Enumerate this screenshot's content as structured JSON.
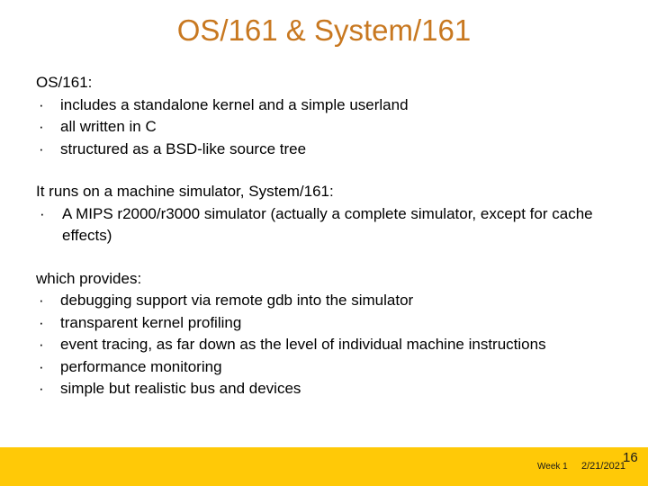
{
  "slide": {
    "title": "OS/161 & System/161",
    "title_color": "#c87820",
    "background_color": "#ffffff",
    "blocks": [
      {
        "lead": "OS/161:",
        "bullets": [
          "includes a standalone kernel and a simple userland",
          "all written in C",
          "structured as a BSD-like source tree"
        ]
      },
      {
        "lead": "It runs on a machine simulator, System/161:",
        "bullets": [
          "A MIPS r2000/r3000 simulator (actually a complete simulator, except for cache effects)"
        ]
      },
      {
        "lead": "which provides:",
        "bullets": [
          "debugging support via remote gdb into the simulator",
          "transparent kernel profiling",
          "event tracing, as far down as the level of individual machine instructions",
          "performance monitoring",
          "simple but realistic bus and devices"
        ]
      }
    ]
  },
  "footer": {
    "bar_color": "#ffc907",
    "week_label": "Week 1",
    "date": "2/21/2021",
    "page_number": "16"
  },
  "bullet_glyph": "·"
}
